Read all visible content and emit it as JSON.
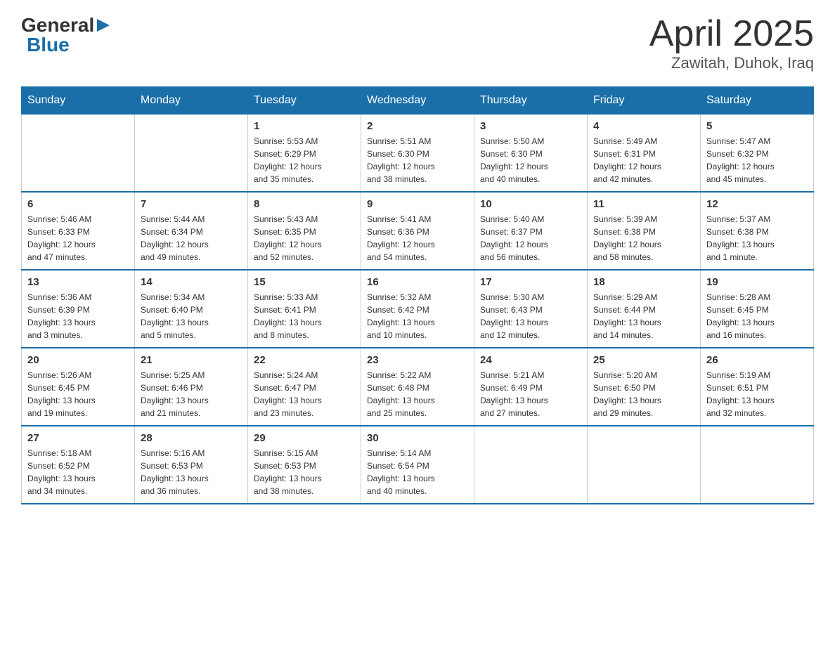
{
  "header": {
    "logo_general": "General",
    "logo_blue": "Blue",
    "month_year": "April 2025",
    "location": "Zawitah, Duhok, Iraq"
  },
  "days_of_week": [
    "Sunday",
    "Monday",
    "Tuesday",
    "Wednesday",
    "Thursday",
    "Friday",
    "Saturday"
  ],
  "weeks": [
    [
      {
        "day": "",
        "info": ""
      },
      {
        "day": "",
        "info": ""
      },
      {
        "day": "1",
        "info": "Sunrise: 5:53 AM\nSunset: 6:29 PM\nDaylight: 12 hours\nand 35 minutes."
      },
      {
        "day": "2",
        "info": "Sunrise: 5:51 AM\nSunset: 6:30 PM\nDaylight: 12 hours\nand 38 minutes."
      },
      {
        "day": "3",
        "info": "Sunrise: 5:50 AM\nSunset: 6:30 PM\nDaylight: 12 hours\nand 40 minutes."
      },
      {
        "day": "4",
        "info": "Sunrise: 5:49 AM\nSunset: 6:31 PM\nDaylight: 12 hours\nand 42 minutes."
      },
      {
        "day": "5",
        "info": "Sunrise: 5:47 AM\nSunset: 6:32 PM\nDaylight: 12 hours\nand 45 minutes."
      }
    ],
    [
      {
        "day": "6",
        "info": "Sunrise: 5:46 AM\nSunset: 6:33 PM\nDaylight: 12 hours\nand 47 minutes."
      },
      {
        "day": "7",
        "info": "Sunrise: 5:44 AM\nSunset: 6:34 PM\nDaylight: 12 hours\nand 49 minutes."
      },
      {
        "day": "8",
        "info": "Sunrise: 5:43 AM\nSunset: 6:35 PM\nDaylight: 12 hours\nand 52 minutes."
      },
      {
        "day": "9",
        "info": "Sunrise: 5:41 AM\nSunset: 6:36 PM\nDaylight: 12 hours\nand 54 minutes."
      },
      {
        "day": "10",
        "info": "Sunrise: 5:40 AM\nSunset: 6:37 PM\nDaylight: 12 hours\nand 56 minutes."
      },
      {
        "day": "11",
        "info": "Sunrise: 5:39 AM\nSunset: 6:38 PM\nDaylight: 12 hours\nand 58 minutes."
      },
      {
        "day": "12",
        "info": "Sunrise: 5:37 AM\nSunset: 6:38 PM\nDaylight: 13 hours\nand 1 minute."
      }
    ],
    [
      {
        "day": "13",
        "info": "Sunrise: 5:36 AM\nSunset: 6:39 PM\nDaylight: 13 hours\nand 3 minutes."
      },
      {
        "day": "14",
        "info": "Sunrise: 5:34 AM\nSunset: 6:40 PM\nDaylight: 13 hours\nand 5 minutes."
      },
      {
        "day": "15",
        "info": "Sunrise: 5:33 AM\nSunset: 6:41 PM\nDaylight: 13 hours\nand 8 minutes."
      },
      {
        "day": "16",
        "info": "Sunrise: 5:32 AM\nSunset: 6:42 PM\nDaylight: 13 hours\nand 10 minutes."
      },
      {
        "day": "17",
        "info": "Sunrise: 5:30 AM\nSunset: 6:43 PM\nDaylight: 13 hours\nand 12 minutes."
      },
      {
        "day": "18",
        "info": "Sunrise: 5:29 AM\nSunset: 6:44 PM\nDaylight: 13 hours\nand 14 minutes."
      },
      {
        "day": "19",
        "info": "Sunrise: 5:28 AM\nSunset: 6:45 PM\nDaylight: 13 hours\nand 16 minutes."
      }
    ],
    [
      {
        "day": "20",
        "info": "Sunrise: 5:26 AM\nSunset: 6:45 PM\nDaylight: 13 hours\nand 19 minutes."
      },
      {
        "day": "21",
        "info": "Sunrise: 5:25 AM\nSunset: 6:46 PM\nDaylight: 13 hours\nand 21 minutes."
      },
      {
        "day": "22",
        "info": "Sunrise: 5:24 AM\nSunset: 6:47 PM\nDaylight: 13 hours\nand 23 minutes."
      },
      {
        "day": "23",
        "info": "Sunrise: 5:22 AM\nSunset: 6:48 PM\nDaylight: 13 hours\nand 25 minutes."
      },
      {
        "day": "24",
        "info": "Sunrise: 5:21 AM\nSunset: 6:49 PM\nDaylight: 13 hours\nand 27 minutes."
      },
      {
        "day": "25",
        "info": "Sunrise: 5:20 AM\nSunset: 6:50 PM\nDaylight: 13 hours\nand 29 minutes."
      },
      {
        "day": "26",
        "info": "Sunrise: 5:19 AM\nSunset: 6:51 PM\nDaylight: 13 hours\nand 32 minutes."
      }
    ],
    [
      {
        "day": "27",
        "info": "Sunrise: 5:18 AM\nSunset: 6:52 PM\nDaylight: 13 hours\nand 34 minutes."
      },
      {
        "day": "28",
        "info": "Sunrise: 5:16 AM\nSunset: 6:53 PM\nDaylight: 13 hours\nand 36 minutes."
      },
      {
        "day": "29",
        "info": "Sunrise: 5:15 AM\nSunset: 6:53 PM\nDaylight: 13 hours\nand 38 minutes."
      },
      {
        "day": "30",
        "info": "Sunrise: 5:14 AM\nSunset: 6:54 PM\nDaylight: 13 hours\nand 40 minutes."
      },
      {
        "day": "",
        "info": ""
      },
      {
        "day": "",
        "info": ""
      },
      {
        "day": "",
        "info": ""
      }
    ]
  ]
}
